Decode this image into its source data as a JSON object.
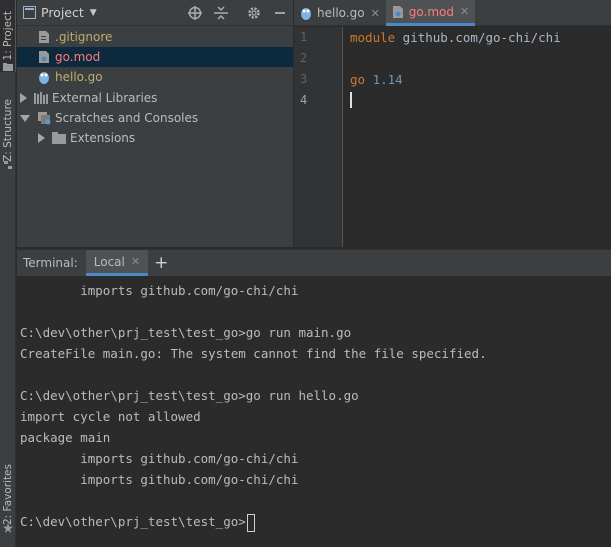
{
  "toolstrip": {
    "project_tab": "1: Project",
    "structure_tab": "Z: Structure",
    "favorites_tab": "2: Favorites"
  },
  "project": {
    "title": "Project",
    "files": [
      {
        "name": ".gitignore",
        "icon": "file-icon",
        "color": "#bfae6a"
      },
      {
        "name": "go.mod",
        "icon": "gomod-icon",
        "color": "#ff7a7a"
      },
      {
        "name": "hello.go",
        "icon": "gopher-icon",
        "color": "#bfae6a"
      }
    ],
    "external_libraries": "External Libraries",
    "scratches": "Scratches and Consoles",
    "extensions": "Extensions"
  },
  "editor": {
    "tabs": [
      {
        "label": "hello.go",
        "active": false
      },
      {
        "label": "go.mod",
        "active": true
      }
    ],
    "line_numbers": [
      "1",
      "2",
      "3",
      "4"
    ],
    "code": {
      "line1_keyword": "module",
      "line1_value": " github.com/go-chi/chi",
      "line3_keyword": "go",
      "line3_value": " 1.14"
    }
  },
  "terminal": {
    "title": "Terminal:",
    "tab_label": "Local",
    "lines": [
      "        imports github.com/go-chi/chi",
      "",
      "C:\\dev\\other\\prj_test\\test_go>go run main.go",
      "CreateFile main.go: The system cannot find the file specified.",
      "",
      "C:\\dev\\other\\prj_test\\test_go>go run hello.go",
      "import cycle not allowed",
      "package main",
      "        imports github.com/go-chi/chi",
      "        imports github.com/go-chi/chi",
      ""
    ],
    "prompt": "C:\\dev\\other\\prj_test\\test_go>"
  }
}
